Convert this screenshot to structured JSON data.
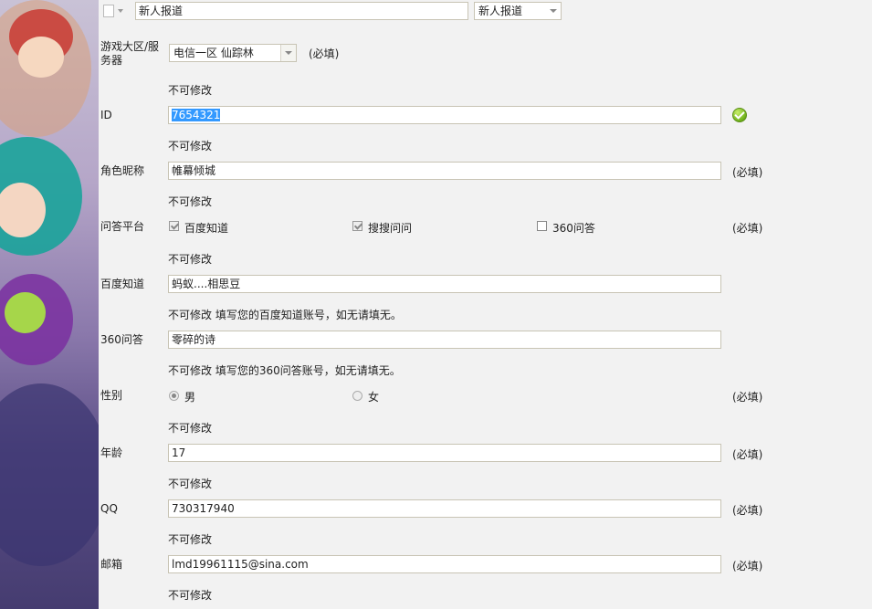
{
  "header": {
    "title_value": "新人报道",
    "category_value": "新人报道"
  },
  "server": {
    "label": "游戏大区/服务器",
    "selected": "电信一区 仙踪林",
    "required": "(必填)"
  },
  "id_field": {
    "note": "不可修改",
    "label": "ID",
    "value": "7654321"
  },
  "nickname": {
    "note": "不可修改",
    "label": "角色昵称",
    "value": "帷幕倾城",
    "required": "(必填)"
  },
  "platform": {
    "note": "不可修改",
    "label": "问答平台",
    "options": [
      {
        "label": "百度知道",
        "checked": true
      },
      {
        "label": "搜搜问问",
        "checked": true
      },
      {
        "label": "360问答",
        "checked": false
      }
    ],
    "required": "(必填)"
  },
  "baidu": {
    "note": "不可修改",
    "label": "百度知道",
    "value": "蚂蚁....相思豆",
    "hint": "不可修改  填写您的百度知道账号，如无请填无。"
  },
  "q360": {
    "label": "360问答",
    "value": "零碎的诗",
    "hint": "不可修改  填写您的360问答账号，如无请填无。"
  },
  "gender": {
    "label": "性别",
    "options": [
      {
        "label": "男",
        "checked": true
      },
      {
        "label": "女",
        "checked": false
      }
    ],
    "required": "(必填)"
  },
  "age": {
    "note": "不可修改",
    "label": "年龄",
    "value": "17",
    "required": "(必填)"
  },
  "qq": {
    "note": "不可修改",
    "label": "QQ",
    "value": "730317940",
    "required": "(必填)"
  },
  "email": {
    "note": "不可修改",
    "label": "邮箱",
    "value": "lmd19961115@sina.com",
    "required": "(必填)"
  },
  "footer_note": "不可修改"
}
